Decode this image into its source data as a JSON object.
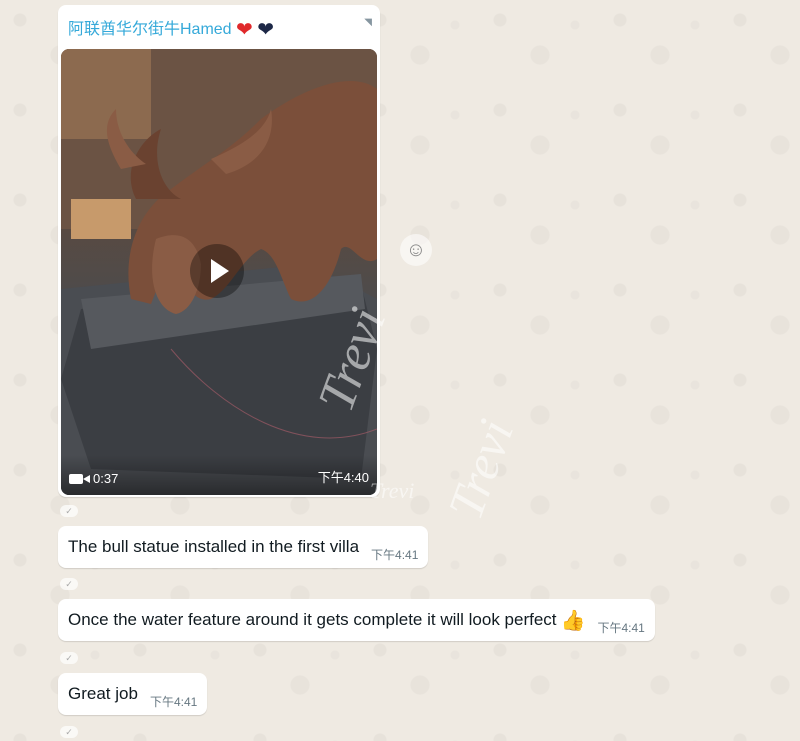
{
  "chat": {
    "sender_name": "阿联酋华尔街牛Hamed",
    "video": {
      "duration": "0:37",
      "time": "下午4:40"
    },
    "messages": [
      {
        "text": "The bull statue installed in the first villa",
        "time": "下午4:41"
      },
      {
        "text": "Once the water feature around it gets complete it will look perfect",
        "time": "下午4:41",
        "emoji": "👍"
      },
      {
        "text": "Great job",
        "time": "下午4:41"
      }
    ]
  },
  "watermark": {
    "text": "Trevi"
  },
  "icons": {
    "reaction": "emoji-reaction-icon",
    "video": "video-camera-icon",
    "play": "play-icon",
    "hearts": [
      "red-heart-icon",
      "dark-heart-icon"
    ]
  },
  "colors": {
    "sender": "#35a9d9",
    "background": "#efeae2",
    "bubble": "#ffffff"
  }
}
